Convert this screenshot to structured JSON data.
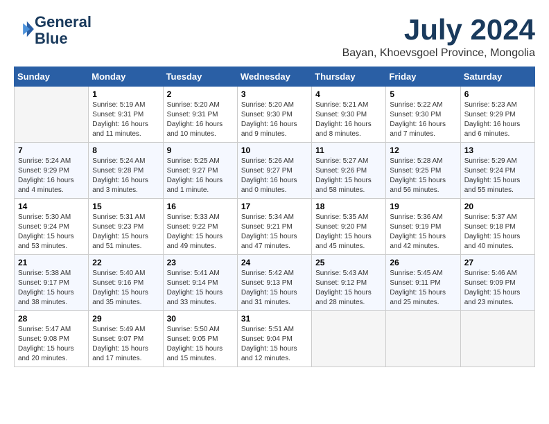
{
  "header": {
    "logo_line1": "General",
    "logo_line2": "Blue",
    "month": "July 2024",
    "location": "Bayan, Khoevsgoel Province, Mongolia"
  },
  "weekdays": [
    "Sunday",
    "Monday",
    "Tuesday",
    "Wednesday",
    "Thursday",
    "Friday",
    "Saturday"
  ],
  "weeks": [
    [
      {
        "day": "",
        "sunrise": "",
        "sunset": "",
        "daylight": "",
        "empty": true
      },
      {
        "day": "1",
        "sunrise": "Sunrise: 5:19 AM",
        "sunset": "Sunset: 9:31 PM",
        "daylight": "Daylight: 16 hours and 11 minutes."
      },
      {
        "day": "2",
        "sunrise": "Sunrise: 5:20 AM",
        "sunset": "Sunset: 9:31 PM",
        "daylight": "Daylight: 16 hours and 10 minutes."
      },
      {
        "day": "3",
        "sunrise": "Sunrise: 5:20 AM",
        "sunset": "Sunset: 9:30 PM",
        "daylight": "Daylight: 16 hours and 9 minutes."
      },
      {
        "day": "4",
        "sunrise": "Sunrise: 5:21 AM",
        "sunset": "Sunset: 9:30 PM",
        "daylight": "Daylight: 16 hours and 8 minutes."
      },
      {
        "day": "5",
        "sunrise": "Sunrise: 5:22 AM",
        "sunset": "Sunset: 9:30 PM",
        "daylight": "Daylight: 16 hours and 7 minutes."
      },
      {
        "day": "6",
        "sunrise": "Sunrise: 5:23 AM",
        "sunset": "Sunset: 9:29 PM",
        "daylight": "Daylight: 16 hours and 6 minutes."
      }
    ],
    [
      {
        "day": "7",
        "sunrise": "Sunrise: 5:24 AM",
        "sunset": "Sunset: 9:29 PM",
        "daylight": "Daylight: 16 hours and 4 minutes."
      },
      {
        "day": "8",
        "sunrise": "Sunrise: 5:24 AM",
        "sunset": "Sunset: 9:28 PM",
        "daylight": "Daylight: 16 hours and 3 minutes."
      },
      {
        "day": "9",
        "sunrise": "Sunrise: 5:25 AM",
        "sunset": "Sunset: 9:27 PM",
        "daylight": "Daylight: 16 hours and 1 minute."
      },
      {
        "day": "10",
        "sunrise": "Sunrise: 5:26 AM",
        "sunset": "Sunset: 9:27 PM",
        "daylight": "Daylight: 16 hours and 0 minutes."
      },
      {
        "day": "11",
        "sunrise": "Sunrise: 5:27 AM",
        "sunset": "Sunset: 9:26 PM",
        "daylight": "Daylight: 15 hours and 58 minutes."
      },
      {
        "day": "12",
        "sunrise": "Sunrise: 5:28 AM",
        "sunset": "Sunset: 9:25 PM",
        "daylight": "Daylight: 15 hours and 56 minutes."
      },
      {
        "day": "13",
        "sunrise": "Sunrise: 5:29 AM",
        "sunset": "Sunset: 9:24 PM",
        "daylight": "Daylight: 15 hours and 55 minutes."
      }
    ],
    [
      {
        "day": "14",
        "sunrise": "Sunrise: 5:30 AM",
        "sunset": "Sunset: 9:24 PM",
        "daylight": "Daylight: 15 hours and 53 minutes."
      },
      {
        "day": "15",
        "sunrise": "Sunrise: 5:31 AM",
        "sunset": "Sunset: 9:23 PM",
        "daylight": "Daylight: 15 hours and 51 minutes."
      },
      {
        "day": "16",
        "sunrise": "Sunrise: 5:33 AM",
        "sunset": "Sunset: 9:22 PM",
        "daylight": "Daylight: 15 hours and 49 minutes."
      },
      {
        "day": "17",
        "sunrise": "Sunrise: 5:34 AM",
        "sunset": "Sunset: 9:21 PM",
        "daylight": "Daylight: 15 hours and 47 minutes."
      },
      {
        "day": "18",
        "sunrise": "Sunrise: 5:35 AM",
        "sunset": "Sunset: 9:20 PM",
        "daylight": "Daylight: 15 hours and 45 minutes."
      },
      {
        "day": "19",
        "sunrise": "Sunrise: 5:36 AM",
        "sunset": "Sunset: 9:19 PM",
        "daylight": "Daylight: 15 hours and 42 minutes."
      },
      {
        "day": "20",
        "sunrise": "Sunrise: 5:37 AM",
        "sunset": "Sunset: 9:18 PM",
        "daylight": "Daylight: 15 hours and 40 minutes."
      }
    ],
    [
      {
        "day": "21",
        "sunrise": "Sunrise: 5:38 AM",
        "sunset": "Sunset: 9:17 PM",
        "daylight": "Daylight: 15 hours and 38 minutes."
      },
      {
        "day": "22",
        "sunrise": "Sunrise: 5:40 AM",
        "sunset": "Sunset: 9:16 PM",
        "daylight": "Daylight: 15 hours and 35 minutes."
      },
      {
        "day": "23",
        "sunrise": "Sunrise: 5:41 AM",
        "sunset": "Sunset: 9:14 PM",
        "daylight": "Daylight: 15 hours and 33 minutes."
      },
      {
        "day": "24",
        "sunrise": "Sunrise: 5:42 AM",
        "sunset": "Sunset: 9:13 PM",
        "daylight": "Daylight: 15 hours and 31 minutes."
      },
      {
        "day": "25",
        "sunrise": "Sunrise: 5:43 AM",
        "sunset": "Sunset: 9:12 PM",
        "daylight": "Daylight: 15 hours and 28 minutes."
      },
      {
        "day": "26",
        "sunrise": "Sunrise: 5:45 AM",
        "sunset": "Sunset: 9:11 PM",
        "daylight": "Daylight: 15 hours and 25 minutes."
      },
      {
        "day": "27",
        "sunrise": "Sunrise: 5:46 AM",
        "sunset": "Sunset: 9:09 PM",
        "daylight": "Daylight: 15 hours and 23 minutes."
      }
    ],
    [
      {
        "day": "28",
        "sunrise": "Sunrise: 5:47 AM",
        "sunset": "Sunset: 9:08 PM",
        "daylight": "Daylight: 15 hours and 20 minutes."
      },
      {
        "day": "29",
        "sunrise": "Sunrise: 5:49 AM",
        "sunset": "Sunset: 9:07 PM",
        "daylight": "Daylight: 15 hours and 17 minutes."
      },
      {
        "day": "30",
        "sunrise": "Sunrise: 5:50 AM",
        "sunset": "Sunset: 9:05 PM",
        "daylight": "Daylight: 15 hours and 15 minutes."
      },
      {
        "day": "31",
        "sunrise": "Sunrise: 5:51 AM",
        "sunset": "Sunset: 9:04 PM",
        "daylight": "Daylight: 15 hours and 12 minutes."
      },
      {
        "day": "",
        "sunrise": "",
        "sunset": "",
        "daylight": "",
        "empty": true
      },
      {
        "day": "",
        "sunrise": "",
        "sunset": "",
        "daylight": "",
        "empty": true
      },
      {
        "day": "",
        "sunrise": "",
        "sunset": "",
        "daylight": "",
        "empty": true
      }
    ]
  ]
}
